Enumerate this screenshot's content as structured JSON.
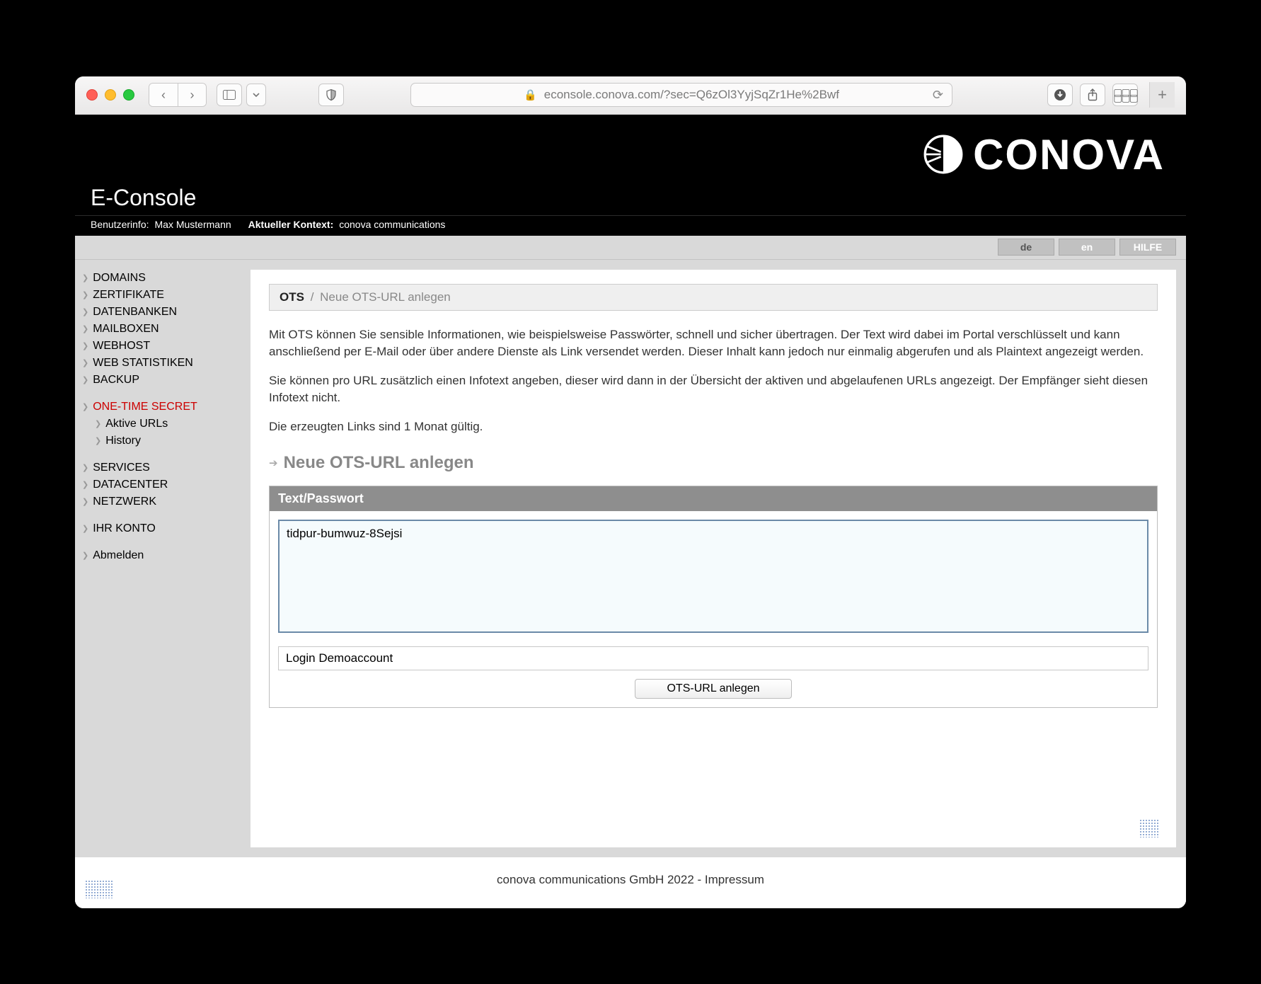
{
  "browser": {
    "url": "econsole.conova.com/?sec=Q6zOl3YyjSqZr1He%2Bwf"
  },
  "header": {
    "brand": "CONOVA",
    "app_title": "E-Console",
    "userinfo_label": "Benutzerinfo:",
    "userinfo_value": "Max Mustermann",
    "context_label": "Aktueller Kontext:",
    "context_value": "conova communications"
  },
  "langbar": {
    "de": "de",
    "en": "en",
    "help": "HILFE"
  },
  "sidebar": {
    "items": [
      {
        "label": "DOMAINS"
      },
      {
        "label": "ZERTIFIKATE"
      },
      {
        "label": "DATENBANKEN"
      },
      {
        "label": "MAILBOXEN"
      },
      {
        "label": "WEBHOST"
      },
      {
        "label": "WEB STATISTIKEN"
      },
      {
        "label": "BACKUP"
      }
    ],
    "active": {
      "label": "ONE-TIME SECRET"
    },
    "active_sub": [
      {
        "label": "Aktive URLs"
      },
      {
        "label": "History"
      }
    ],
    "items2": [
      {
        "label": "SERVICES"
      },
      {
        "label": "DATACENTER"
      },
      {
        "label": "NETZWERK"
      }
    ],
    "items3": [
      {
        "label": "IHR KONTO"
      }
    ],
    "items4": [
      {
        "label": "Abmelden"
      }
    ]
  },
  "breadcrumb": {
    "root": "OTS",
    "sep": "/",
    "current": "Neue OTS-URL anlegen"
  },
  "content": {
    "p1": "Mit OTS können Sie sensible Informationen, wie beispielsweise Passwörter, schnell und sicher übertragen. Der Text wird dabei im Portal verschlüsselt und kann anschließend per E-Mail oder über andere Dienste als Link versendet werden. Dieser Inhalt kann jedoch nur einmalig abgerufen und als Plaintext angezeigt werden.",
    "p2": "Sie können pro URL zusätzlich einen Infotext angeben, dieser wird dann in der Übersicht der aktiven und abgelaufenen URLs angezeigt. Der Empfänger sieht diesen Infotext nicht.",
    "p3": "Die erzeugten Links sind 1 Monat gültig.",
    "section_heading": "Neue OTS-URL anlegen",
    "panel_title": "Text/Passwort",
    "textarea_value": "tidpur-bumwuz-8Sejsi",
    "infotext_value": "Login Demoaccount",
    "submit_label": "OTS-URL anlegen"
  },
  "footer": {
    "text": "conova communications GmbH 2022 - Impressum"
  }
}
